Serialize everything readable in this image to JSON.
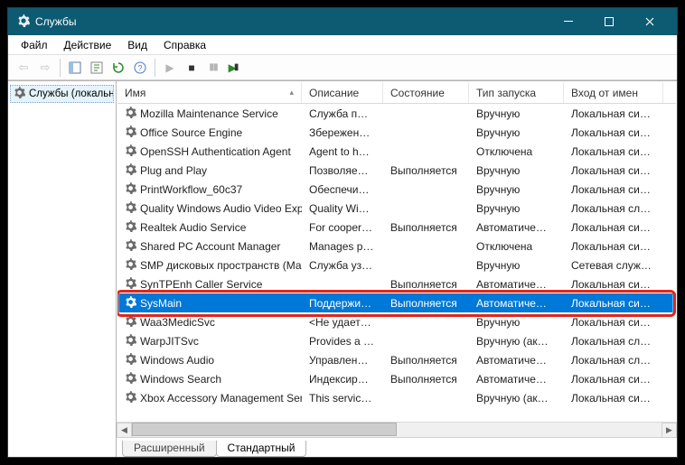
{
  "window": {
    "title": "Службы"
  },
  "menu": {
    "file": "Файл",
    "action": "Действие",
    "view": "Вид",
    "help": "Справка"
  },
  "sidebar": {
    "label": "Службы (локальн"
  },
  "columns": {
    "name": "Имя",
    "desc": "Описание",
    "state": "Состояние",
    "start": "Тип запуска",
    "user": "Вход от имен"
  },
  "tabs": {
    "extended": "Расширенный",
    "standard": "Стандартный"
  },
  "rows": [
    {
      "name": "Mozilla Maintenance Service",
      "desc": "Служба п…",
      "state": "",
      "start": "Вручную",
      "user": "Локальная си…"
    },
    {
      "name": "Office  Source Engine",
      "desc": "Збережен…",
      "state": "",
      "start": "Вручную",
      "user": "Локальная си…"
    },
    {
      "name": "OpenSSH Authentication Agent",
      "desc": "Agent to h…",
      "state": "",
      "start": "Отключена",
      "user": "Локальная си…"
    },
    {
      "name": "Plug and Play",
      "desc": "Позволяе…",
      "state": "Выполняется",
      "start": "Вручную",
      "user": "Локальная си…"
    },
    {
      "name": "PrintWorkflow_60c37",
      "desc": "Обеспечи…",
      "state": "",
      "start": "Вручную",
      "user": "Локальная си…"
    },
    {
      "name": "Quality Windows Audio Video Experien…",
      "desc": "Quality Wi…",
      "state": "",
      "start": "Вручную",
      "user": "Локальная сл…"
    },
    {
      "name": "Realtek Audio Service",
      "desc": "For cooper…",
      "state": "Выполняется",
      "start": "Автоматиче…",
      "user": "Локальная си…"
    },
    {
      "name": "Shared PC Account Manager",
      "desc": "Manages p…",
      "state": "",
      "start": "Отключена",
      "user": "Локальная си…"
    },
    {
      "name": "SMP дисковых пространств (Майкро…",
      "desc": "Служба уз…",
      "state": "",
      "start": "Вручную",
      "user": "Сетевая служ…"
    },
    {
      "name": "SynTPEnh Caller Service",
      "desc": "",
      "state": "Выполняется",
      "start": "Автоматиче…",
      "user": "Локальная си…"
    },
    {
      "name": "SysMain",
      "desc": "Поддержи…",
      "state": "Выполняется",
      "start": "Автоматиче…",
      "user": "Локальная си…",
      "selected": true
    },
    {
      "name": "Waa3MedicSvc",
      "desc": "<Не удает…",
      "state": "",
      "start": "Вручную",
      "user": "Локальная си…"
    },
    {
      "name": "WarpJITSvc",
      "desc": "Provides a …",
      "state": "",
      "start": "Вручную (ак…",
      "user": "Локальная сл…"
    },
    {
      "name": "Windows Audio",
      "desc": "Управлен…",
      "state": "Выполняется",
      "start": "Автоматиче…",
      "user": "Локальная сл…"
    },
    {
      "name": "Windows Search",
      "desc": "Индексир…",
      "state": "Выполняется",
      "start": "Автоматиче…",
      "user": "Локальная си…"
    },
    {
      "name": "Xbox Accessory Management Service",
      "desc": "This servic…",
      "state": "",
      "start": "Вручную (ак…",
      "user": "Локальная си…"
    }
  ]
}
